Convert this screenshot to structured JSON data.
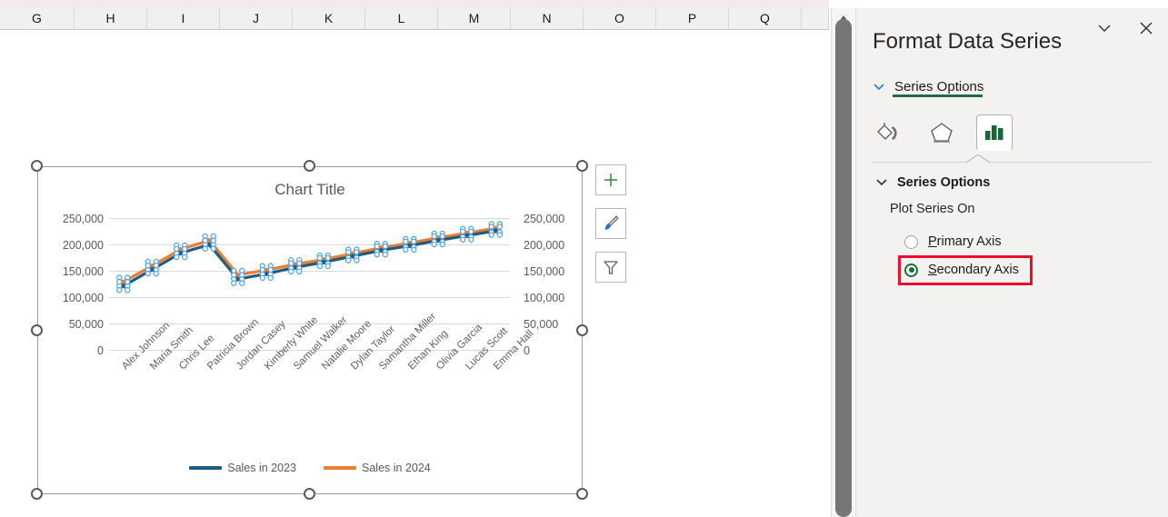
{
  "spreadsheet": {
    "column_headers": [
      "G",
      "H",
      "I",
      "J",
      "K",
      "L",
      "M",
      "N",
      "O",
      "P",
      "Q"
    ],
    "scrollbar": {
      "up_arrow_icon": "triangle-up-icon"
    }
  },
  "chart": {
    "title": "Chart Title",
    "side_buttons": [
      {
        "name": "chart-elements-button",
        "icon": "plus-icon",
        "color": "#3c8a45"
      },
      {
        "name": "chart-styles-button",
        "icon": "paintbrush-icon",
        "color": "#2e75b6"
      },
      {
        "name": "chart-filters-button",
        "icon": "funnel-icon",
        "color": "#595959"
      }
    ],
    "legend": [
      {
        "label": "Sales in 2023",
        "color": "#1F5C82"
      },
      {
        "label": "Sales in 2024",
        "color": "#ED7D31"
      }
    ]
  },
  "chart_data": {
    "type": "line",
    "title": "Chart Title",
    "xlabel": "",
    "ylabel": "",
    "ylim": [
      0,
      250000
    ],
    "yticks": [
      "0",
      "50,000",
      "100,000",
      "150,000",
      "200,000",
      "250,000"
    ],
    "secondary_ylim": [
      0,
      250000
    ],
    "secondary_yticks": [
      "0",
      "50,000",
      "100,000",
      "150,000",
      "200,000",
      "250,000"
    ],
    "grid": true,
    "legend_position": "bottom",
    "markers": "selected-data-points",
    "categories": [
      "Alex Johnson",
      "Maria Smith",
      "Chris Lee",
      "Patricia Brown",
      "Jordan Casey",
      "Kimberly White",
      "Samuel Walker",
      "Natalie Moore",
      "Dylan Taylor",
      "Samantha Miller",
      "Ethan King",
      "Olivia Garcia",
      "Lucas Scott",
      "Emma Hall"
    ],
    "series": [
      {
        "name": "Sales in 2023",
        "color": "#1F5C82",
        "axis": "primary",
        "values": [
          122000,
          153000,
          184000,
          200000,
          135000,
          145000,
          157000,
          167000,
          178000,
          189000,
          198000,
          208000,
          217000,
          226000
        ]
      },
      {
        "name": "Sales in 2024",
        "color": "#ED7D31",
        "axis": "secondary",
        "values": [
          130000,
          160000,
          191000,
          208000,
          143000,
          152000,
          163000,
          172000,
          183000,
          194000,
          203000,
          213000,
          222000,
          231000
        ]
      }
    ]
  },
  "pane": {
    "title": "Format Data Series",
    "collapse_icon": "chevron-down-icon",
    "close_icon": "close-icon",
    "nav_label": "Series Options",
    "nav_expand_icon": "chevron-down-icon",
    "tabs": [
      {
        "name": "fill-and-line-tab",
        "icon": "paint-bucket-icon",
        "selected": false
      },
      {
        "name": "effects-tab",
        "icon": "pentagon-icon",
        "selected": false
      },
      {
        "name": "series-options-tab",
        "icon": "bar-chart-icon",
        "selected": true
      }
    ],
    "section_title": "Series Options",
    "section_expand_icon": "chevron-down-icon",
    "plot_series_on_label": "Plot Series On",
    "options": [
      {
        "label": "Primary Axis",
        "accel": "P",
        "rest": "rimary Axis",
        "selected": false
      },
      {
        "label": "Secondary Axis",
        "accel": "S",
        "rest": "econdary Axis",
        "selected": true
      }
    ],
    "accent_color": "#17703a",
    "highlight_color": "#e8112d"
  }
}
